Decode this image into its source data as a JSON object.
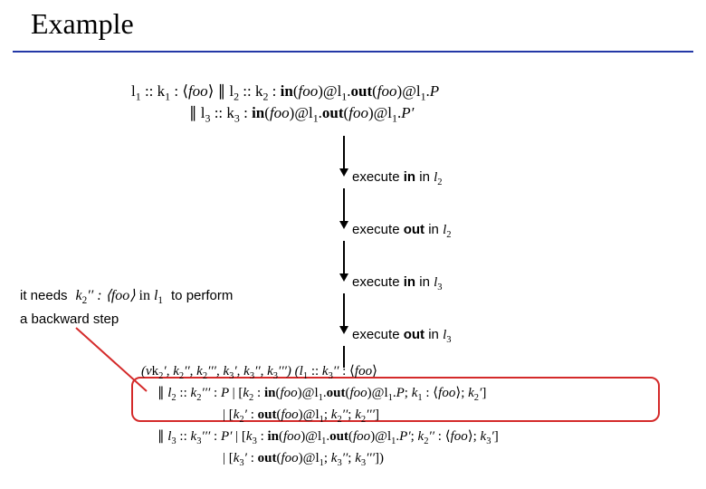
{
  "title": "Example",
  "top_formula": {
    "line1": "l₁ :: k₁ : ⟨foo⟩ ∥ l₂ :: k₂ : in(foo)@l₁.out(foo)@l₁.P",
    "line2": "∥ l₃ :: k₃ : in(foo)@l₁.out(foo)@l₁.P′"
  },
  "steps": [
    {
      "prefix": "execute ",
      "bold": "in",
      "mid": " in ",
      "loc": "l",
      "sub": "2"
    },
    {
      "prefix": "execute ",
      "bold": "out",
      "mid": " in ",
      "loc": "l",
      "sub": "2"
    },
    {
      "prefix": "execute ",
      "bold": "in",
      "mid": " in ",
      "loc": "l",
      "sub": "3"
    },
    {
      "prefix": "execute ",
      "bold": "out",
      "mid": " in ",
      "loc": "l",
      "sub": "3"
    }
  ],
  "need": {
    "before": "it needs",
    "math": "k₂′′ : ⟨foo⟩ in l₁",
    "after": "to perform"
  },
  "backward": "a backward step",
  "big_formula": {
    "r1": "(νk₂′, k₂′′, k₂′′′, k₃′, k₃′′, k₃′′′) (l₁ :: k₃′′ : ⟨foo⟩",
    "r2": "∥ l₂ :: k₂′′′ : P | [k₂ : in(foo)@l₁.out(foo)@l₁.P; k₁ : ⟨foo⟩; k₂′]",
    "r3": "| [k₂′ : out(foo)@l₁; k₂′′; k₂′′′]",
    "r4": "∥ l₃ :: k₃′′′ : P′ | [k₃ : in(foo)@l₁.out(foo)@l₁.P′; k₂′′ : ⟨foo⟩; k₃′]",
    "r5": "| [k₃′ : out(foo)@l₁; k₃′′; k₃′′′])"
  }
}
